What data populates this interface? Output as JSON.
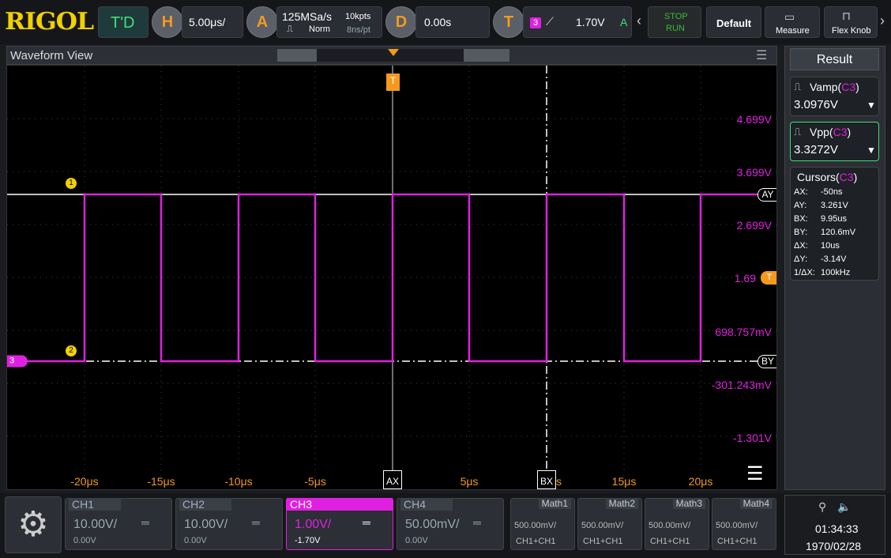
{
  "top": {
    "logo": "RIGOL",
    "mode": "T'D",
    "h_key": "H",
    "timebase": "5.00μs/",
    "a_key": "A",
    "sample_rate": "125MSa/s",
    "acq_mode": "Norm",
    "mem_depth": "10kpts",
    "pts": "8ns/pt",
    "d_key": "D",
    "delay": "0.00s",
    "t_key": "T",
    "trig_ch": "3",
    "trig_level": "1.70V",
    "trig_status": "A",
    "stop_label": "STOP",
    "run_label": "RUN",
    "default_label": "Default",
    "measure_label": "Measure",
    "flexknob_label": "Flex Knob"
  },
  "waveform": {
    "title": "Waveform View",
    "y_labels": [
      "4.699V",
      "3.699V",
      "2.699V",
      "1.69",
      "698.757mV",
      "-301.243mV",
      "-1.301V"
    ],
    "x_labels": [
      "-20μs",
      "-15μs",
      "-10μs",
      "-5μs",
      "5μs",
      "15μs",
      "20μs"
    ],
    "cursor_ay": "AY",
    "cursor_by": "BY",
    "cursor_ax": "AX",
    "cursor_bx": "BX",
    "bx_overlap": "s",
    "trig_marker": "T",
    "ch_marker": "3",
    "marker1": "1",
    "marker2": "2"
  },
  "result": {
    "title": "Result",
    "vamp_label": "Vamp(",
    "vamp_src": "C3",
    "vamp_value": "3.0976V",
    "vpp_label": "Vpp(",
    "vpp_src": "C3",
    "vpp_value": "3.3272V",
    "cursors_label": "Cursors(",
    "cursors_src": "C3",
    "close_paren": ")",
    "cursors": [
      {
        "k": "AX:",
        "v": "-50ns"
      },
      {
        "k": "AY:",
        "v": "3.261V"
      },
      {
        "k": "BX:",
        "v": "9.95us"
      },
      {
        "k": "BY:",
        "v": "120.6mV"
      },
      {
        "k": "ΔX:",
        "v": "10us"
      },
      {
        "k": "ΔY:",
        "v": "-3.14V"
      },
      {
        "k": "1/ΔX:",
        "v": "100kHz"
      }
    ]
  },
  "channels": [
    {
      "name": "CH1",
      "scale": "10.00V/",
      "offset": "0.00V"
    },
    {
      "name": "CH2",
      "scale": "10.00V/",
      "offset": "0.00V"
    },
    {
      "name": "CH3",
      "scale": "1.00V/",
      "offset": "-1.70V"
    },
    {
      "name": "CH4",
      "scale": "50.00mV/",
      "offset": "0.00V"
    }
  ],
  "maths": [
    {
      "name": "Math1",
      "scale": "500.00mV/",
      "src": "CH1+CH1"
    },
    {
      "name": "Math2",
      "scale": "500.00mV/",
      "src": "CH1+CH1"
    },
    {
      "name": "Math3",
      "scale": "500.00mV/",
      "src": "CH1+CH1"
    },
    {
      "name": "Math4",
      "scale": "500.00mV/",
      "src": "CH1+CH1"
    }
  ],
  "status": {
    "time": "01:34:33",
    "date": "1970/02/28"
  },
  "colors": {
    "ch3": "#e020e0",
    "trigger": "#f39a1e",
    "logo": "#f2d000",
    "stop_run": "#3dbb3d"
  }
}
